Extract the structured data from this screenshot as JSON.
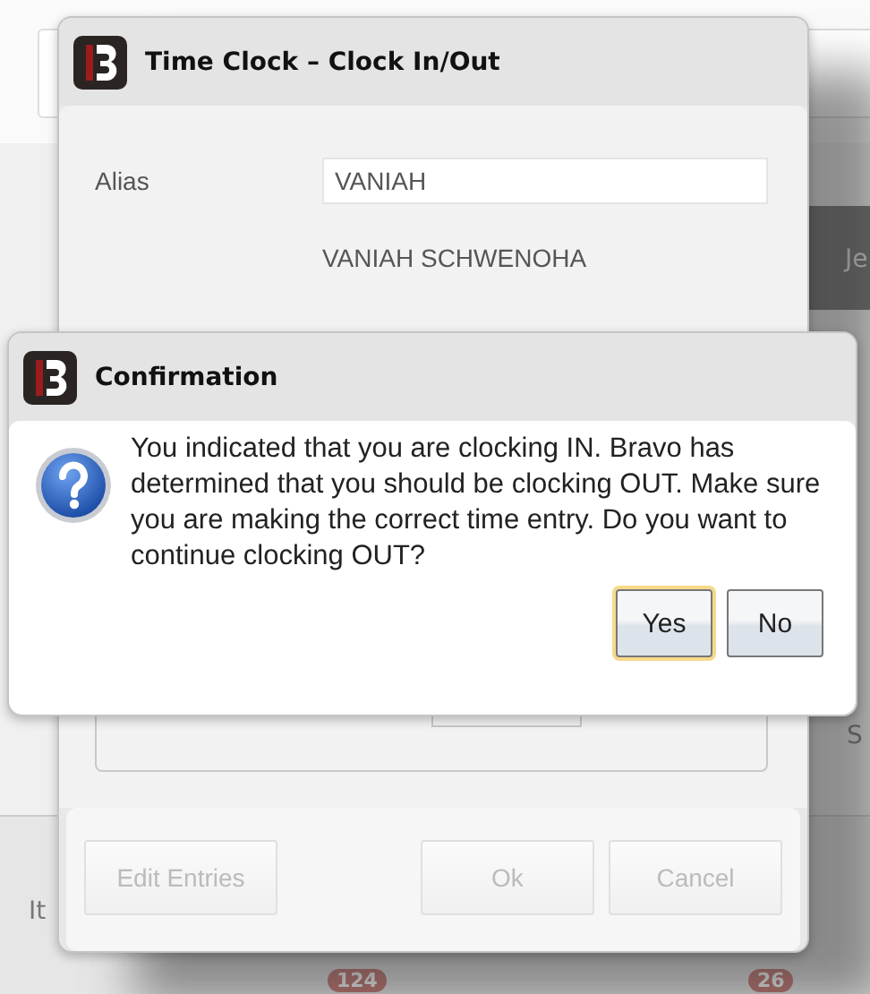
{
  "background": {
    "texts": [
      {
        "kind": "label",
        "text": "Je"
      },
      {
        "kind": "label",
        "text": "S"
      },
      {
        "kind": "label",
        "text": "It"
      },
      {
        "kind": "badge",
        "text": "124"
      },
      {
        "kind": "badge",
        "text": "26"
      }
    ]
  },
  "time_clock": {
    "title": "Time Clock – Clock In/Out",
    "alias": {
      "label": "Alias",
      "value": "VANIAH"
    },
    "full_name": "VANIAH SCHWENOHA",
    "buttons": [
      {
        "label": "Edit Entries",
        "disabled": true
      },
      {
        "label": "Ok",
        "disabled": true
      },
      {
        "label": "Cancel",
        "disabled": true
      }
    ]
  },
  "confirmation": {
    "title": "Confirmation",
    "message": "You indicated that you are clocking IN. Bravo has determined that you should be clocking OUT. Make sure you are making the correct time entry. Do you want to continue clocking OUT?",
    "buttons": [
      {
        "label": "Yes",
        "default": true
      },
      {
        "label": "No",
        "default": false
      }
    ]
  }
}
